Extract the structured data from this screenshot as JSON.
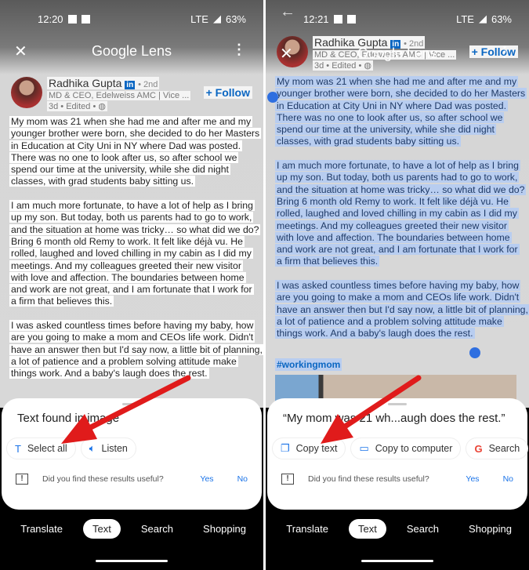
{
  "app_title": "Google Lens",
  "post": {
    "author": "Radhika Gupta",
    "network_badge": "in",
    "degree": "• 2nd",
    "headline": "MD & CEO, Edelweiss AMC | Vice ...",
    "meta": "3d • Edited •",
    "follow_label": "+ Follow",
    "hashtag": "#workingmom",
    "paragraphs": [
      [
        "My mom was 21 when she had me and after me and my",
        "younger brother were born, she decided to do her Masters",
        "in Education at City Uni in NY where Dad was posted.",
        "There was no one to look after us, so after school we",
        "spend our time at the university, while she did night",
        "classes, with grad students baby sitting us."
      ],
      [
        "I am much more fortunate, to have a lot of help as I bring",
        "up my son.  But today, both us parents had to go to work,",
        "and the situation at home was tricky… so what did we do?",
        "Bring 6 month old Remy to work.  It felt like déjà vu.  He",
        "rolled, laughed and loved chilling in my cabin as I did my",
        "meetings.  And my colleagues greeted their new visitor",
        "with love and affection.  The boundaries between home",
        "and work are not great, and I am fortunate that I work for",
        "a firm that believes this."
      ],
      [
        "I was asked countless times before having my baby, how",
        "are you going to make a mom and CEOs life work.  Didn't",
        "have an answer then but I'd say now, a little bit of planning,",
        "a lot of patience and a problem solving attitude make",
        "things work.  And a baby's laugh does the rest."
      ]
    ]
  },
  "left": {
    "status": {
      "time": "12:20",
      "network": "LTE",
      "battery": "63%"
    },
    "sheet_title": "Text found in image",
    "chips": [
      {
        "icon": "text-icon",
        "label": "Select all"
      },
      {
        "icon": "speaker-icon",
        "label": "Listen"
      }
    ]
  },
  "right": {
    "status": {
      "time": "12:21",
      "network": "LTE",
      "battery": "63%"
    },
    "sheet_title": "“My mom was 21 wh...augh does the rest.”",
    "chips": [
      {
        "icon": "copy-icon",
        "label": "Copy text"
      },
      {
        "icon": "computer-icon",
        "label": "Copy to computer"
      },
      {
        "icon": "google-icon",
        "label": "Search"
      }
    ]
  },
  "feedback": {
    "question": "Did you find these results useful?",
    "yes": "Yes",
    "no": "No"
  },
  "nav": {
    "tabs": [
      "Translate",
      "Text",
      "Search",
      "Shopping"
    ],
    "selected": "Text"
  },
  "colors": {
    "highlight": "#b8cdf0",
    "accent": "#1a73e8",
    "arrow": "#e01b1b"
  }
}
